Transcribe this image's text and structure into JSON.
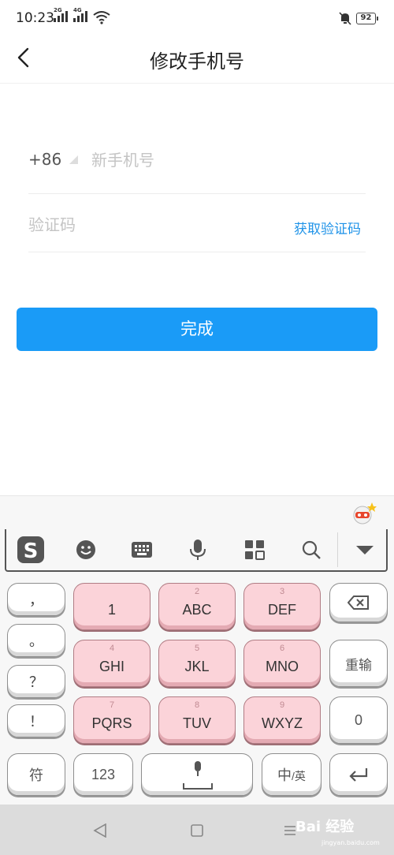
{
  "status_bar": {
    "time": "10:23",
    "sim1_tag": "2G",
    "sim2_tag": "4G",
    "battery": "92"
  },
  "header": {
    "title": "修改手机号"
  },
  "form": {
    "country_code": "+86",
    "phone_placeholder": "新手机号",
    "code_placeholder": "验证码",
    "get_code_label": "获取验证码"
  },
  "submit_label": "完成",
  "keyboard": {
    "toolbar_icons": [
      "sogou-logo-icon",
      "emoji-icon",
      "keyboard-icon",
      "microphone-icon",
      "apps-grid-icon",
      "search-icon",
      "collapse-keyboard-icon"
    ],
    "punct_keys": [
      "，",
      "。",
      "？",
      "！"
    ],
    "t9_keys": [
      {
        "num": "",
        "main": "1"
      },
      {
        "num": "2",
        "main": "ABC"
      },
      {
        "num": "3",
        "main": "DEF"
      },
      {
        "num": "4",
        "main": "GHI"
      },
      {
        "num": "5",
        "main": "JKL"
      },
      {
        "num": "6",
        "main": "MNO"
      },
      {
        "num": "7",
        "main": "PQRS"
      },
      {
        "num": "8",
        "main": "TUV"
      },
      {
        "num": "9",
        "main": "WXYZ"
      }
    ],
    "reenter_label": "重输",
    "zero_label": "0",
    "symbol_label": "符",
    "num_label": "123",
    "lang_label_main": "中",
    "lang_label_sub": "/英"
  },
  "watermark": {
    "text": "Bai 经验",
    "sub": "jingyan.baidu.com"
  },
  "colors": {
    "accent": "#1a9bf7",
    "link": "#1f93e8",
    "key_pink": "#fbd3d9"
  }
}
